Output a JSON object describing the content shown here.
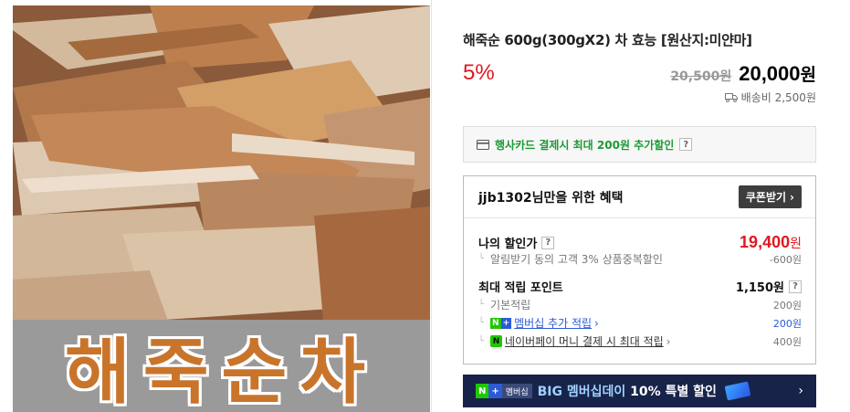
{
  "product": {
    "image_overlay_text": "해죽순차",
    "title": "해죽순 600g(300gX2) 차 효능 [원산지:미얀마]",
    "discount_rate": "5%",
    "original_price": "20,500원",
    "sale_price_num": "20,000",
    "sale_price_unit": "원",
    "shipping": "배송비 2,500원"
  },
  "card_promo": {
    "text": "행사카드 결제시 최대 200원 추가할인",
    "help": "?"
  },
  "benefit": {
    "title": "jjb1302님만을 위한 혜택",
    "coupon_button": "쿠폰받기",
    "my_price_label": "나의 할인가",
    "my_price_help": "?",
    "my_price_num": "19,400",
    "my_price_unit": "원",
    "my_price_sub": "알림받기 동의 고객 3% 상품중복할인",
    "my_price_sub_value": "-600원",
    "points_label": "최대 적립 포인트",
    "points_value": "1,150원",
    "points_help": "?",
    "basic_label": "기본적립",
    "basic_value": "200원",
    "membership_label": "멤버십 추가 적립",
    "membership_value": "200원",
    "npay_label": "네이버페이 머니 결제 시 최대 적립",
    "npay_value": "400원"
  },
  "banner": {
    "badge_n": "N",
    "badge_plus": "+",
    "badge_text": "멤버십",
    "text_blue": "BIG 멤버십데이 ",
    "text_white": "10% 특별 할인"
  },
  "colors": {
    "accent_red": "#e0191e",
    "naver_green": "#1ec800",
    "link_blue": "#2d5bd7",
    "banner_bg": "#172349"
  }
}
